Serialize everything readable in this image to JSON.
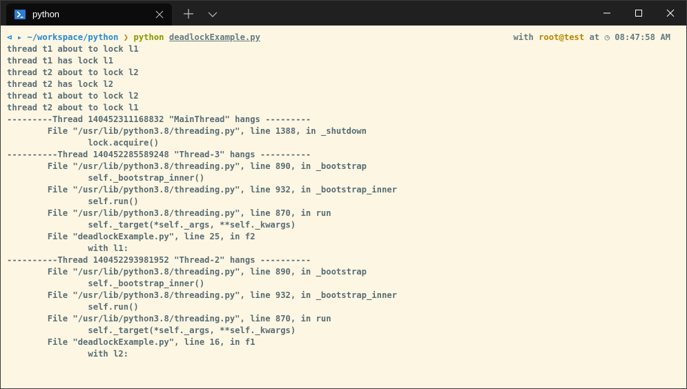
{
  "window": {
    "tab_title": "python",
    "icons": {
      "tab": "powershell-icon",
      "close_tab": "close-icon",
      "new_tab": "plus-icon",
      "dropdown": "chevron-down-icon",
      "minimize": "minimize-icon",
      "maximize": "maximize-icon",
      "close": "close-window-icon"
    }
  },
  "prompt": {
    "indicator": "⊲",
    "folder_icon": "▸",
    "path": "~/workspace/python",
    "arrow": "❯",
    "command": "python",
    "argument": "deadlockExample.py",
    "right_with": "with",
    "right_user": "root@test",
    "right_at": "at",
    "clock_icon": "◷",
    "time": "08:47:58 AM"
  },
  "output": [
    "thread t1 about to lock l1",
    "thread t1 has lock l1",
    "thread t2 about to lock l2",
    "thread t2 has lock l2",
    "thread t1 about to lock l2",
    "thread t2 about to lock l1",
    "---------Thread 140452311168832 \"MainThread\" hangs ---------",
    "        File \"/usr/lib/python3.8/threading.py\", line 1388, in _shutdown",
    "                lock.acquire()",
    "----------Thread 140452285589248 \"Thread-3\" hangs ----------",
    "        File \"/usr/lib/python3.8/threading.py\", line 890, in _bootstrap",
    "                self._bootstrap_inner()",
    "        File \"/usr/lib/python3.8/threading.py\", line 932, in _bootstrap_inner",
    "                self.run()",
    "        File \"/usr/lib/python3.8/threading.py\", line 870, in run",
    "                self._target(*self._args, **self._kwargs)",
    "        File \"deadlockExample.py\", line 25, in f2",
    "                with l1:",
    "----------Thread 140452293981952 \"Thread-2\" hangs ----------",
    "        File \"/usr/lib/python3.8/threading.py\", line 890, in _bootstrap",
    "                self._bootstrap_inner()",
    "        File \"/usr/lib/python3.8/threading.py\", line 932, in _bootstrap_inner",
    "                self.run()",
    "        File \"/usr/lib/python3.8/threading.py\", line 870, in run",
    "                self._target(*self._args, **self._kwargs)",
    "        File \"deadlockExample.py\", line 16, in f1",
    "                with l2:"
  ],
  "colors": {
    "background": "#fdf6e3",
    "text": "#586e75",
    "path": "#268bd2",
    "command": "#859900",
    "user": "#b58900",
    "titlebar": "#202020",
    "tab": "#0c0c0c"
  }
}
